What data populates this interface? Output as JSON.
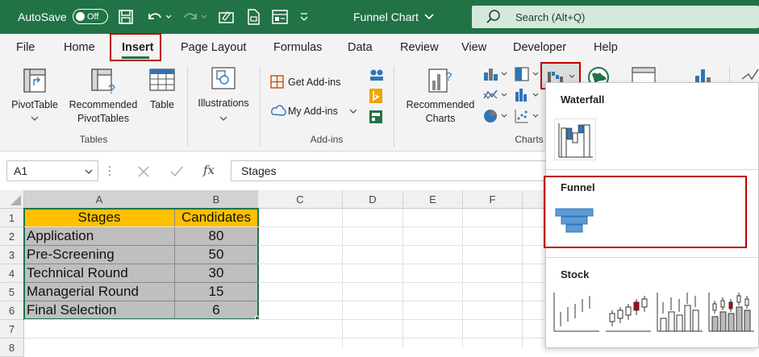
{
  "titlebar": {
    "autosave_label": "AutoSave",
    "toggle_state": "Off",
    "file_title": "Funnel Chart",
    "search_placeholder": "Search (Alt+Q)"
  },
  "menu": {
    "items": [
      "File",
      "Home",
      "Insert",
      "Page Layout",
      "Formulas",
      "Data",
      "Review",
      "View",
      "Developer",
      "Help"
    ],
    "active": "Insert"
  },
  "ribbon": {
    "pivottable": "PivotTable",
    "recommended_pivot_1": "Recommended",
    "recommended_pivot_2": "PivotTables",
    "table": "Table",
    "illustrations": "Illustrations",
    "get_addins": "Get Add-ins",
    "my_addins": "My Add-ins",
    "recommended_charts_1": "Recommended",
    "recommended_charts_2": "Charts",
    "group_tables": "Tables",
    "group_addins": "Add-ins",
    "group_charts": "Charts"
  },
  "formula_bar": {
    "name_box": "A1",
    "content": "Stages"
  },
  "sheet": {
    "columns": [
      "A",
      "B",
      "C",
      "D",
      "E",
      "F"
    ],
    "rows": [
      "1",
      "2",
      "3",
      "4",
      "5",
      "6",
      "7",
      "8"
    ],
    "header": [
      "Stages",
      "Candidates"
    ],
    "data": [
      [
        "Application",
        "80"
      ],
      [
        "Pre-Screening",
        "50"
      ],
      [
        "Technical Round",
        "30"
      ],
      [
        "Managerial Round",
        "15"
      ],
      [
        "Final Selection",
        "6"
      ]
    ]
  },
  "chart_dropdown": {
    "waterfall": "Waterfall",
    "funnel": "Funnel",
    "stock": "Stock"
  },
  "colors": {
    "excel_green": "#217346",
    "highlight_red": "#c00000",
    "header_fill": "#ffc000",
    "data_fill": "#bfbfbf",
    "funnel_blue": "#5b9bd5"
  }
}
